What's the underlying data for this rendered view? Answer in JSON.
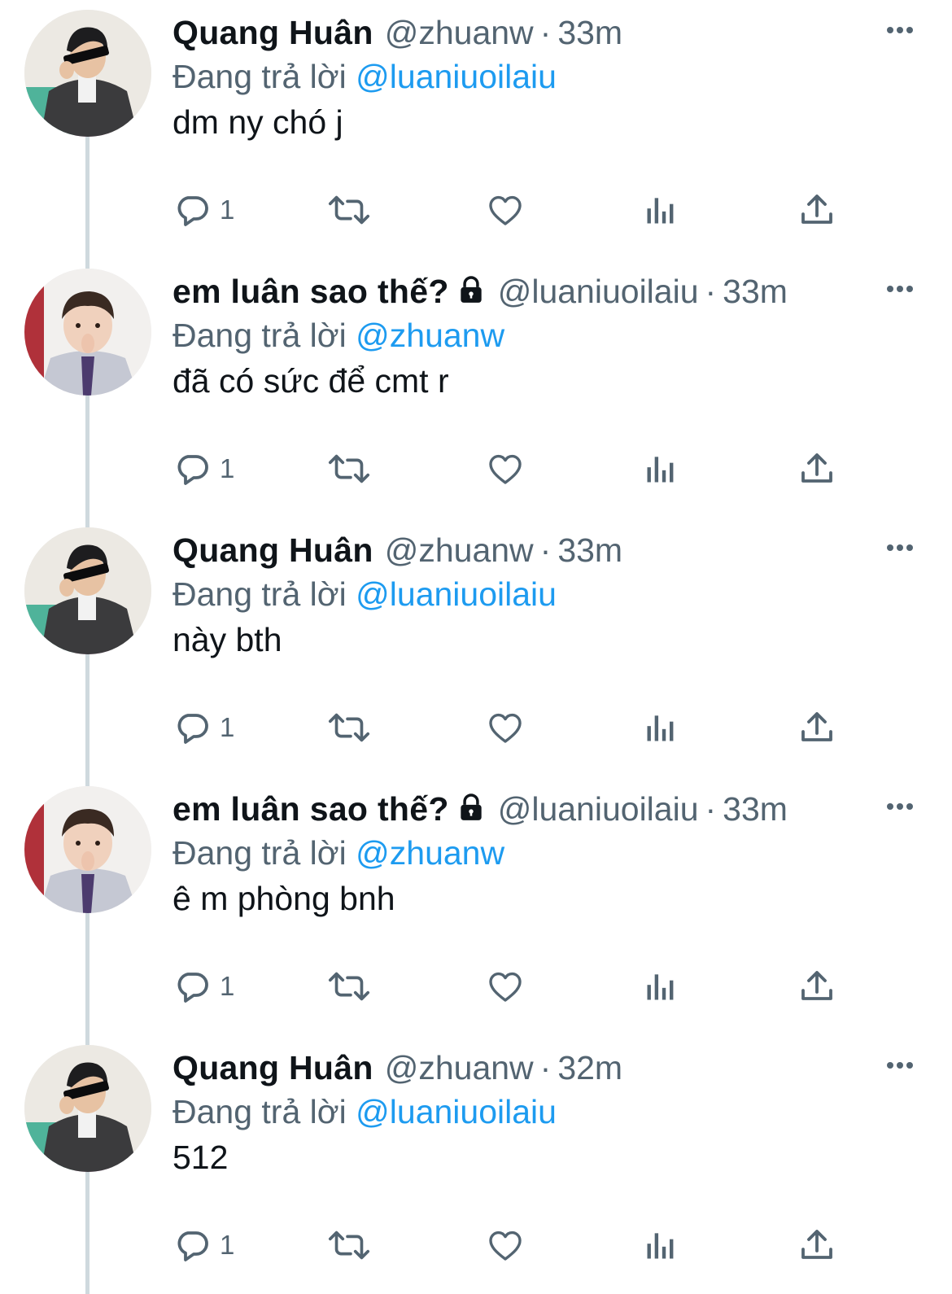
{
  "reply_prefix": "Đang trả lời",
  "tweets": [
    {
      "name": "Quang Huân",
      "locked": false,
      "handle": "@zhuanw",
      "time": "33m",
      "reply_to": "@luaniuoilaiu",
      "text": "dm ny chó j",
      "reply_count": "1",
      "avatar": "guy-with-sunglasses"
    },
    {
      "name": "em luân sao thế?",
      "locked": true,
      "handle": "@luaniuoilaiu",
      "time": "33m",
      "reply_to": "@zhuanw",
      "text": "đã có sức để cmt r",
      "reply_count": "1",
      "avatar": "toddler-in-shirt"
    },
    {
      "name": "Quang Huân",
      "locked": false,
      "handle": "@zhuanw",
      "time": "33m",
      "reply_to": "@luaniuoilaiu",
      "text": "này bth",
      "reply_count": "1",
      "avatar": "guy-with-sunglasses"
    },
    {
      "name": "em luân sao thế?",
      "locked": true,
      "handle": "@luaniuoilaiu",
      "time": "33m",
      "reply_to": "@zhuanw",
      "text": "ê m phòng bnh",
      "reply_count": "1",
      "avatar": "toddler-in-shirt"
    },
    {
      "name": "Quang Huân",
      "locked": false,
      "handle": "@zhuanw",
      "time": "32m",
      "reply_to": "@luaniuoilaiu",
      "text": "512",
      "reply_count": "1",
      "avatar": "guy-with-sunglasses"
    }
  ],
  "colors": {
    "link": "#1d9bf0",
    "muted": "#536471",
    "text": "#0f1419",
    "thread_line": "#cfd9de"
  },
  "icons": [
    "reply-icon",
    "retweet-icon",
    "like-icon",
    "analytics-icon",
    "share-icon",
    "more-icon",
    "lock-icon"
  ]
}
